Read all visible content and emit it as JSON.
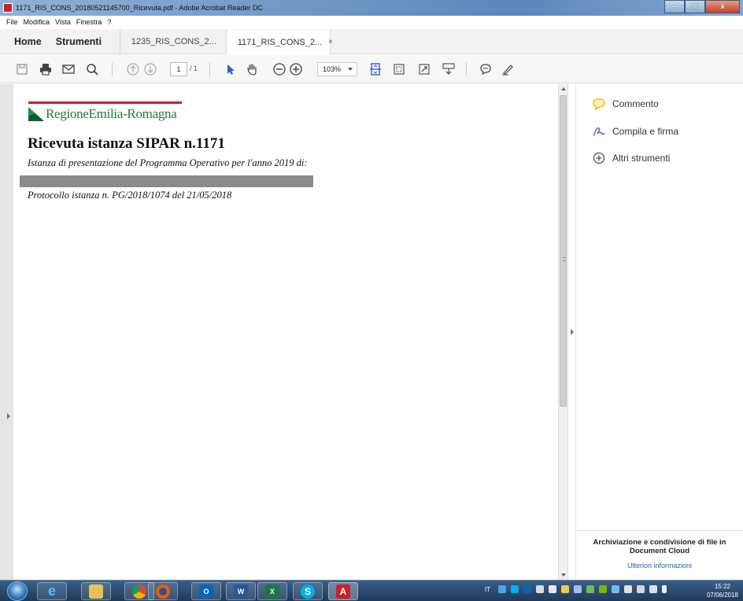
{
  "window": {
    "title": "1171_RIS_CONS_20180521145700_Ricevuta.pdf - Adobe Acrobat Reader DC",
    "minimize": "–",
    "maximize": "□",
    "close": "x"
  },
  "menu": [
    "File",
    "Modifica",
    "Vista",
    "Finestra",
    "?"
  ],
  "tabs": {
    "home": "Home",
    "tools": "Strumenti",
    "doc_tabs": [
      {
        "label": "1235_RIS_CONS_2...",
        "active": false
      },
      {
        "label": "1171_RIS_CONS_2...",
        "active": true,
        "close": "×"
      }
    ]
  },
  "toolbar": {
    "icons": [
      "save-icon",
      "print-icon",
      "email-icon",
      "search-icon",
      "page-up-icon",
      "page-down-icon",
      "select-cursor-icon",
      "hand-tool-icon",
      "zoom-out-icon",
      "zoom-in-icon",
      "fit-page-icon",
      "marquee-zoom-icon",
      "full-screen-icon",
      "read-mode-icon",
      "comment-icon",
      "sign-icon"
    ],
    "page_current": "1",
    "page_total": "/ 1",
    "zoom": "103%"
  },
  "document": {
    "logo_text": "RegioneEmilia-Romagna",
    "title": "Ricevuta istanza SIPAR n.1171",
    "subtitle": "Istanza di presentazione del Programma Operativo per l'anno 2019 di:",
    "protocol": "Protocollo istanza n. PG/2018/1074 del 21/05/2018",
    "colors": {
      "logo_green": "#1f7a3c",
      "logo_red": "#c8202c",
      "redaction": "#8a8a8a"
    }
  },
  "right_pane": {
    "items": [
      {
        "label": "Commento",
        "icon": "comment-bubble-icon"
      },
      {
        "label": "Compila e firma",
        "icon": "fill-sign-icon"
      },
      {
        "label": "Altri strumenti",
        "icon": "plus-circle-icon"
      }
    ],
    "footer_title": "Archiviazione e condivisione di file in Document Cloud",
    "footer_link": "Ulteriori informazioni"
  },
  "taskbar": {
    "apps": [
      "start-orb-icon",
      "internet-explorer-icon",
      "file-explorer-icon",
      "chrome-icon",
      "firefox-icon",
      "outlook-icon",
      "word-icon",
      "excel-icon",
      "skype-icon",
      "acrobat-icon"
    ],
    "language": "IT",
    "time": "15:22",
    "date": "07/06/2018"
  }
}
